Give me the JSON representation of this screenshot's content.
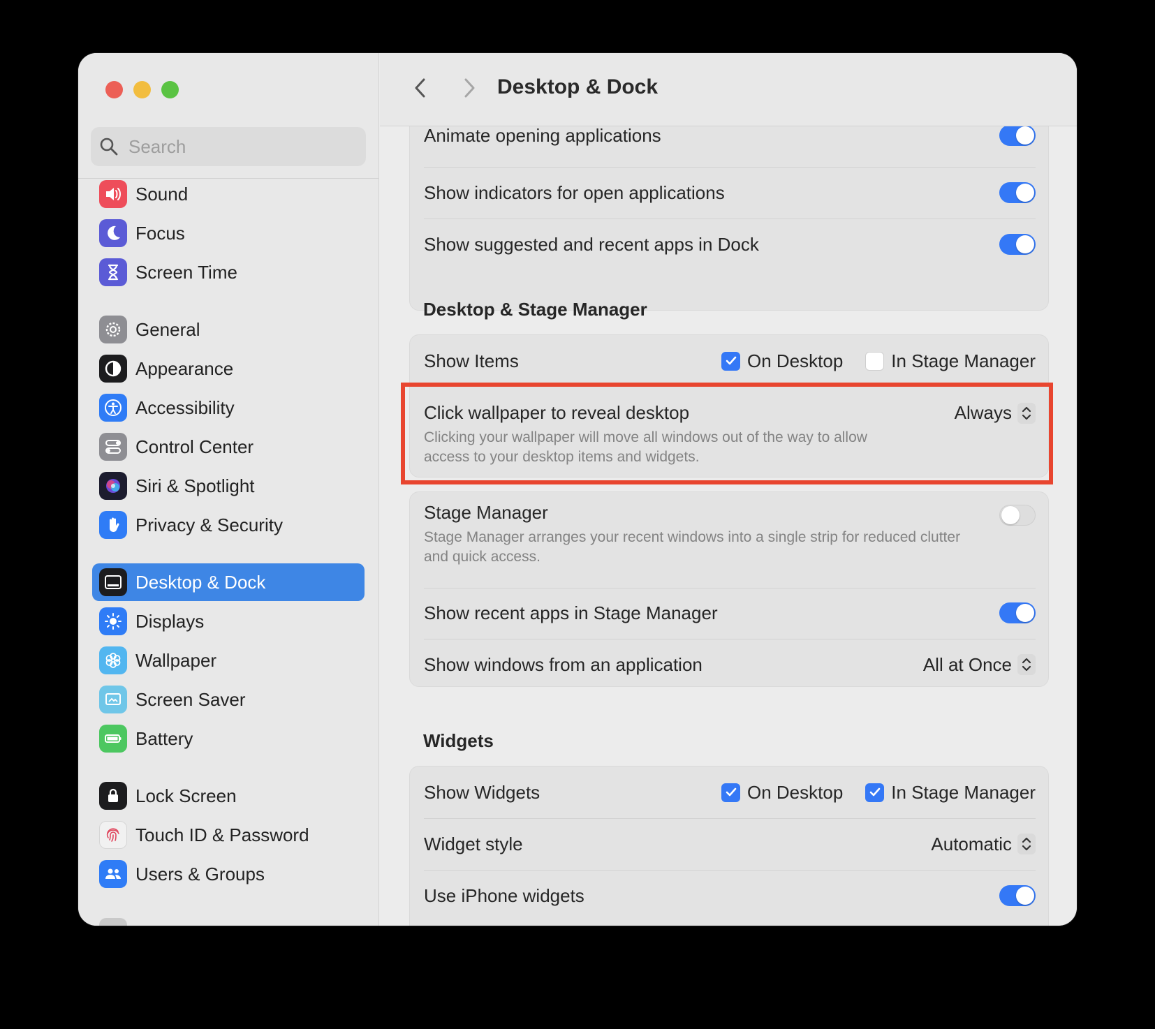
{
  "window": {
    "title": "Desktop & Dock"
  },
  "search": {
    "placeholder": "Search"
  },
  "sidebar": {
    "items": [
      {
        "label": "Sound",
        "icon": "speaker-icon",
        "color": "#ee4d5a"
      },
      {
        "label": "Focus",
        "icon": "moon-icon",
        "color": "#5b5bd6"
      },
      {
        "label": "Screen Time",
        "icon": "hourglass-icon",
        "color": "#5b5bd6"
      },
      {
        "label": "General",
        "icon": "gear-icon",
        "color": "#8e8e93"
      },
      {
        "label": "Appearance",
        "icon": "appearance-icon",
        "color": "#1c1c1e"
      },
      {
        "label": "Accessibility",
        "icon": "accessibility-icon",
        "color": "#2f7cf6"
      },
      {
        "label": "Control Center",
        "icon": "control-center-icon",
        "color": "#8e8e93"
      },
      {
        "label": "Siri & Spotlight",
        "icon": "siri-icon",
        "color": "#3a3a5e"
      },
      {
        "label": "Privacy & Security",
        "icon": "hand-icon",
        "color": "#2f7cf6"
      },
      {
        "label": "Desktop & Dock",
        "icon": "dock-icon",
        "color": "#1c1c1e",
        "active": true
      },
      {
        "label": "Displays",
        "icon": "sun-icon",
        "color": "#2f7cf6"
      },
      {
        "label": "Wallpaper",
        "icon": "flower-icon",
        "color": "#52b6f0"
      },
      {
        "label": "Screen Saver",
        "icon": "screen-saver-icon",
        "color": "#6fc6e8"
      },
      {
        "label": "Battery",
        "icon": "battery-icon",
        "color": "#4cc760"
      },
      {
        "label": "Lock Screen",
        "icon": "lock-icon",
        "color": "#1c1c1e"
      },
      {
        "label": "Touch ID & Password",
        "icon": "fingerprint-icon",
        "color": "#f1f1f1"
      },
      {
        "label": "Users & Groups",
        "icon": "users-icon",
        "color": "#2f7cf6"
      }
    ]
  },
  "dock_section": {
    "rows": [
      {
        "label": "Animate opening applications",
        "toggle": true
      },
      {
        "label": "Show indicators for open applications",
        "toggle": true
      },
      {
        "label": "Show suggested and recent apps in Dock",
        "toggle": true
      }
    ]
  },
  "stage_section": {
    "title": "Desktop & Stage Manager",
    "show_items": {
      "label": "Show Items",
      "on_desktop": {
        "label": "On Desktop",
        "checked": true
      },
      "in_stage_manager": {
        "label": "In Stage Manager",
        "checked": false
      }
    },
    "click_wallpaper": {
      "label": "Click wallpaper to reveal desktop",
      "description": "Clicking your wallpaper will move all windows out of the way to allow access to your desktop items and widgets.",
      "value": "Always"
    },
    "stage_manager": {
      "label": "Stage Manager",
      "description": "Stage Manager arranges your recent windows into a single strip for reduced clutter and quick access.",
      "toggle": false
    },
    "show_recent_apps": {
      "label": "Show recent apps in Stage Manager",
      "toggle": true
    },
    "show_windows": {
      "label": "Show windows from an application",
      "value": "All at Once"
    }
  },
  "widgets_section": {
    "title": "Widgets",
    "show_widgets": {
      "label": "Show Widgets",
      "on_desktop": {
        "label": "On Desktop",
        "checked": true
      },
      "in_stage_manager": {
        "label": "In Stage Manager",
        "checked": true
      }
    },
    "widget_style": {
      "label": "Widget style",
      "value": "Automatic"
    },
    "use_iphone_widgets": {
      "label": "Use iPhone widgets",
      "toggle": true
    }
  },
  "colors": {
    "accent": "#3478f6",
    "highlight_border": "#e8452f",
    "sidebar_active": "#3e86e5"
  }
}
